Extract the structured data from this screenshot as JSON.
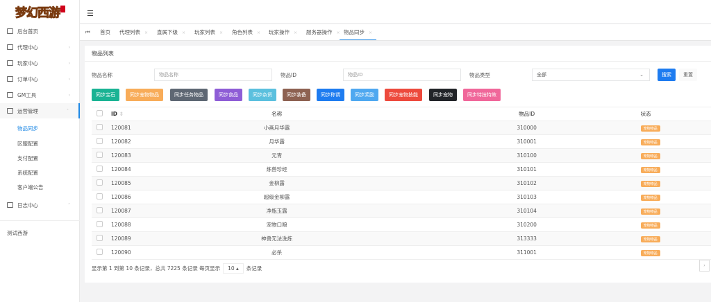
{
  "app": {
    "logo_text": "梦幻西游"
  },
  "sidebar": {
    "items": [
      {
        "label": "后台首页"
      },
      {
        "label": "代理中心"
      },
      {
        "label": "玩家中心"
      },
      {
        "label": "订单中心"
      },
      {
        "label": "GM工具"
      },
      {
        "label": "运营管理"
      },
      {
        "label": "日志中心"
      }
    ],
    "subitems": [
      {
        "label": "物品同步"
      },
      {
        "label": "区服配置"
      },
      {
        "label": "支付配置"
      },
      {
        "label": "系统配置"
      },
      {
        "label": "客户端公告"
      }
    ],
    "footer": "测试西游"
  },
  "tabs": [
    {
      "label": "首页"
    },
    {
      "label": "代理列表"
    },
    {
      "label": "直属下级"
    },
    {
      "label": "玩家列表"
    },
    {
      "label": "角色列表"
    },
    {
      "label": "玩家操作"
    },
    {
      "label": "服务器操作"
    },
    {
      "label": "物品同步"
    }
  ],
  "card": {
    "title": "物品列表",
    "form": {
      "name_label": "物品名称",
      "name_placeholder": "物品名称",
      "id_label": "物品ID",
      "id_placeholder": "物品ID",
      "type_label": "物品类型",
      "type_value": "全部",
      "search": "搜索",
      "reset": "重置"
    },
    "actions": [
      {
        "label": "同步宝石",
        "color": "#1ab394"
      },
      {
        "label": "同步宠物物品",
        "color": "#f8ac59"
      },
      {
        "label": "同步任务物品",
        "color": "#5e6773"
      },
      {
        "label": "同步食品",
        "color": "#8e5dd6"
      },
      {
        "label": "同步杂货",
        "color": "#5bc0de"
      },
      {
        "label": "同步装备",
        "color": "#8d6151"
      },
      {
        "label": "同步称谓",
        "color": "#1e7cf0"
      },
      {
        "label": "同步奖励",
        "color": "#4fa8f0"
      },
      {
        "label": "同步宠物技能",
        "color": "#ed4a3d"
      },
      {
        "label": "同步宠物",
        "color": "#222428"
      },
      {
        "label": "同步特技特效",
        "color": "#f0679a"
      }
    ],
    "table": {
      "headers": [
        "ID",
        "名称",
        "物品ID",
        "状态"
      ],
      "rows": [
        {
          "id": "120081",
          "name": "小画月华露",
          "item_id": "310000",
          "status": "宠物物品"
        },
        {
          "id": "120082",
          "name": "月华露",
          "item_id": "310001",
          "status": "宠物物品"
        },
        {
          "id": "120083",
          "name": "元宵",
          "item_id": "310100",
          "status": "宠物物品"
        },
        {
          "id": "120084",
          "name": "炼兽珍经",
          "item_id": "310101",
          "status": "宠物物品"
        },
        {
          "id": "120085",
          "name": "金柳露",
          "item_id": "310102",
          "status": "宠物物品"
        },
        {
          "id": "120086",
          "name": "超级金柳露",
          "item_id": "310103",
          "status": "宠物物品"
        },
        {
          "id": "120087",
          "name": "净瓶玉露",
          "item_id": "310104",
          "status": "宠物物品"
        },
        {
          "id": "120088",
          "name": "宠物口粮",
          "item_id": "310200",
          "status": "宠物物品"
        },
        {
          "id": "120089",
          "name": "神兽无法洗炼",
          "item_id": "313333",
          "status": "宠物物品"
        },
        {
          "id": "120090",
          "name": "必杀",
          "item_id": "311001",
          "status": "宠物物品"
        }
      ]
    },
    "pagination": {
      "summary": "显示第 1 到第 10 条记录，总共 7225 条记录 每页显示",
      "page_size": "10 ▴",
      "suffix": "条记录",
      "next": "›"
    }
  }
}
